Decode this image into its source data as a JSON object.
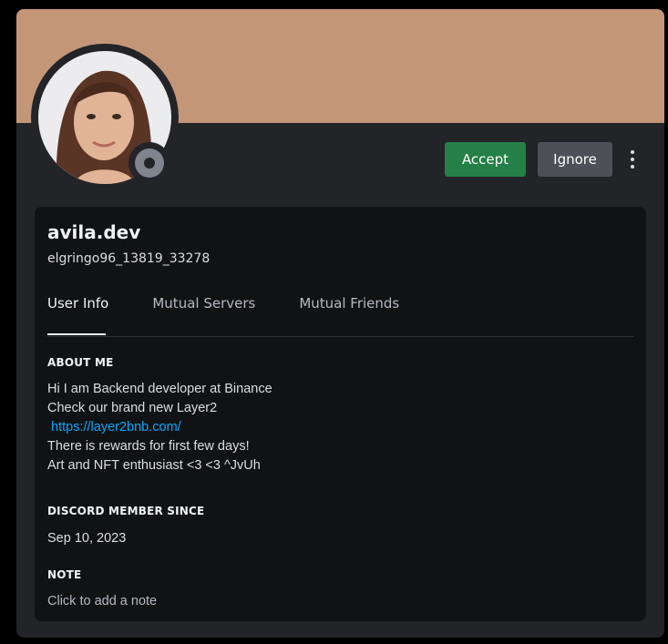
{
  "profile": {
    "display_name": "avila.dev",
    "username": "elgringo96_13819_33278",
    "avatar": "avatar-woman-portrait",
    "status": "offline"
  },
  "actions": {
    "accept_label": "Accept",
    "ignore_label": "Ignore",
    "more_icon": "kebab-menu-icon"
  },
  "tabs": [
    {
      "label": "User Info",
      "active": true
    },
    {
      "label": "Mutual Servers",
      "active": false
    },
    {
      "label": "Mutual Friends",
      "active": false
    }
  ],
  "about": {
    "title": "ABOUT ME",
    "lines": [
      "Hi I am Backend developer at Binance",
      "Check our brand new Layer2",
      " https://layer2bnb.com/",
      "There is rewards for first few days!",
      "Art and NFT enthusiast <3 <3 ^JvUh"
    ]
  },
  "member_since": {
    "title": "DISCORD MEMBER SINCE",
    "date": "Sep 10, 2023"
  },
  "note": {
    "title": "NOTE",
    "placeholder": "Click to add a note"
  },
  "colors": {
    "banner": "#c49678",
    "accept": "#248046",
    "ignore": "#4e5058",
    "link": "#00a8fc",
    "card": "#232428",
    "inner": "#111214"
  }
}
